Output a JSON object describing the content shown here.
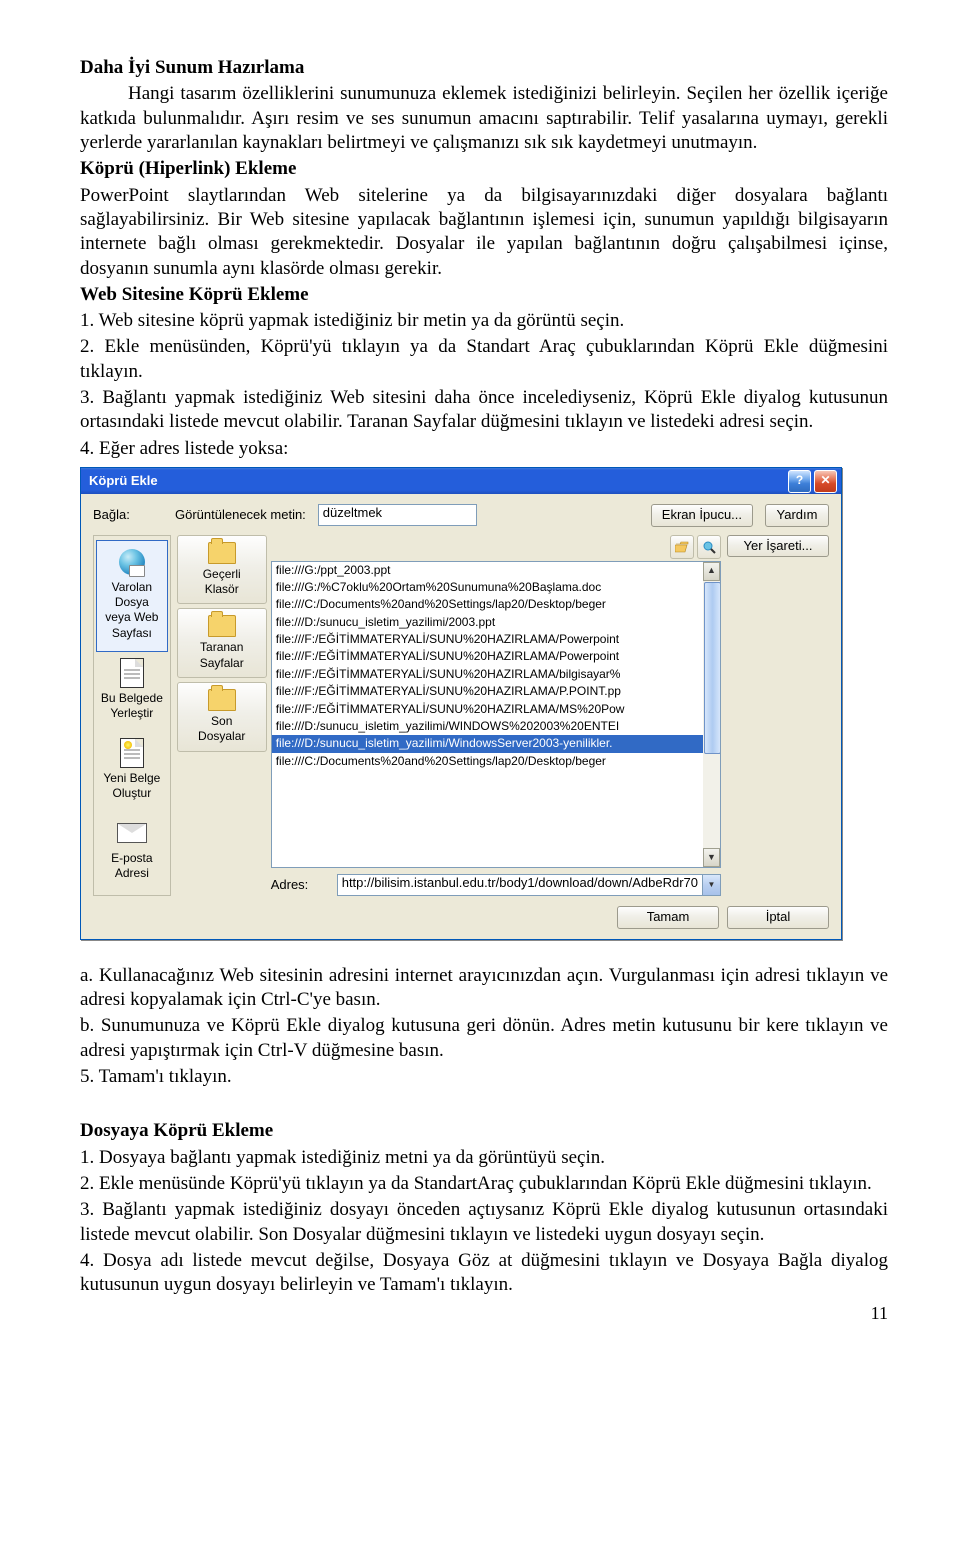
{
  "heading1": "Daha İyi Sunum Hazırlama",
  "para1": "Hangi tasarım özelliklerini sunumunuza eklemek istediğinizi belirleyin. Seçilen her özellik içeriğe katkıda bulunmalıdır. Aşırı resim ve ses sunumun amacını saptırabilir. Telif yasalarına uymayı, gerekli yerlerde yararlanılan kaynakları belirtmeyi ve çalışmanızı sık sık kaydetmeyi unutmayın.",
  "heading2": "Köprü (Hiperlink) Ekleme",
  "para2": "PowerPoint slaytlarından Web sitelerine ya da bilgisayarınızdaki diğer dosyalara bağlantı sağlayabilirsiniz. Bir Web sitesine yapılacak bağlantının işlemesi için, sunumun yapıldığı bilgisayarın internete bağlı olması gerekmektedir. Dosyalar ile yapılan   bağlantının doğru çalışabilmesi içinse, dosyanın sunumla aynı klasörde olması gerekir.",
  "heading3": "Web Sitesine Köprü Ekleme",
  "li1": "1.       Web sitesine köprü yapmak istediğiniz bir metin ya da görüntü seçin.",
  "li2": "2.       Ekle menüsünden, Köprü'yü tıklayın ya da Standart Araç çubuklarından Köprü Ekle düğmesini tıklayın.",
  "li3": "3.       Bağlantı yapmak istediğiniz Web sitesini daha önce incelediyseniz, Köprü Ekle diyalog kutusunun ortasındaki listede mevcut olabilir. Taranan Sayfalar düğmesini tıklayın ve listedeki adresi seçin.",
  "li4": "4.       Eğer adres listede yoksa:",
  "dialog": {
    "title": "Köprü Ekle",
    "link_label": "Bağla:",
    "display_label": "Görüntülenecek metin:",
    "display_value": "düzeltmek",
    "screen_tip": "Ekran İpucu...",
    "help": "Yardım",
    "bookmark": "Yer İşareti...",
    "nav": {
      "existing": "Varolan Dosya\nveya Web\nSayfası",
      "place": "Bu Belgede\nYerleştir",
      "new": "Yeni Belge\nOluştur",
      "email": "E-posta Adresi"
    },
    "thumbs": {
      "current": "Geçerli\nKlasör",
      "browsed": "Taranan\nSayfalar",
      "recent": "Son\nDosyalar"
    },
    "files": [
      "file:///G:/ppt_2003.ppt",
      "file:///G:/%C7oklu%20Ortam%20Sunumuna%20Başlama.doc",
      "file:///C:/Documents%20and%20Settings/lap20/Desktop/beger",
      "file:///D:/sunucu_isletim_yazilimi/2003.ppt",
      "file:///F:/EĞİTİMMATERYALİ/SUNU%20HAZIRLAMA/Powerpoint",
      "file:///F:/EĞİTİMMATERYALİ/SUNU%20HAZIRLAMA/Powerpoint",
      "file:///F:/EĞİTİMMATERYALİ/SUNU%20HAZIRLAMA/bilgisayar%",
      "file:///F:/EĞİTİMMATERYALİ/SUNU%20HAZIRLAMA/P.POINT.pp",
      "file:///F:/EĞİTİMMATERYALİ/SUNU%20HAZIRLAMA/MS%20Pow",
      "file:///D:/sunucu_isletim_yazilimi/WINDOWS%202003%20ENTEI",
      "file:///D:/sunucu_isletim_yazilimi/WindowsServer2003-yenilikler.",
      "file:///C:/Documents%20and%20Settings/lap20/Desktop/beger"
    ],
    "selected_index": 10,
    "address_label": "Adres:",
    "address_value": "http://bilisim.istanbul.edu.tr/body1/download/down/AdbeRdr70",
    "ok": "Tamam",
    "cancel": "İptal"
  },
  "li_a": "a.       Kullanacağınız Web sitesinin adresini internet arayıcınızdan açın. Vurgulanması için adresi tıklayın ve adresi kopyalamak için Ctrl-C'ye basın.",
  "li_b": "b.       Sunumunuza ve Köprü Ekle diyalog kutusuna geri dönün. Adres metin kutusunu bir kere tıklayın ve adresi yapıştırmak için Ctrl-V düğmesine basın.",
  "li5": "5.     Tamam'ı tıklayın.",
  "heading4": "Dosyaya Köprü Ekleme",
  "d_li1": "1.       Dosyaya bağlantı yapmak istediğiniz metni ya da görüntüyü seçin.",
  "d_li2": "2.       Ekle menüsünde Köprü'yü tıklayın ya da StandartAraç çubuklarından Köprü Ekle düğmesini tıklayın.",
  "d_li3": "3.       Bağlantı yapmak istediğiniz dosyayı önceden açtıysanız Köprü Ekle diyalog kutusunun ortasındaki listede mevcut olabilir. Son Dosyalar düğmesini tıklayın ve listedeki uygun dosyayı seçin.",
  "d_li4": "4.       Dosya adı listede mevcut değilse, Dosyaya Göz at düğmesini tıklayın ve Dosyaya Bağla diyalog kutusunun uygun dosyayı belirleyin ve Tamam'ı tıklayın.",
  "page_num": "11"
}
